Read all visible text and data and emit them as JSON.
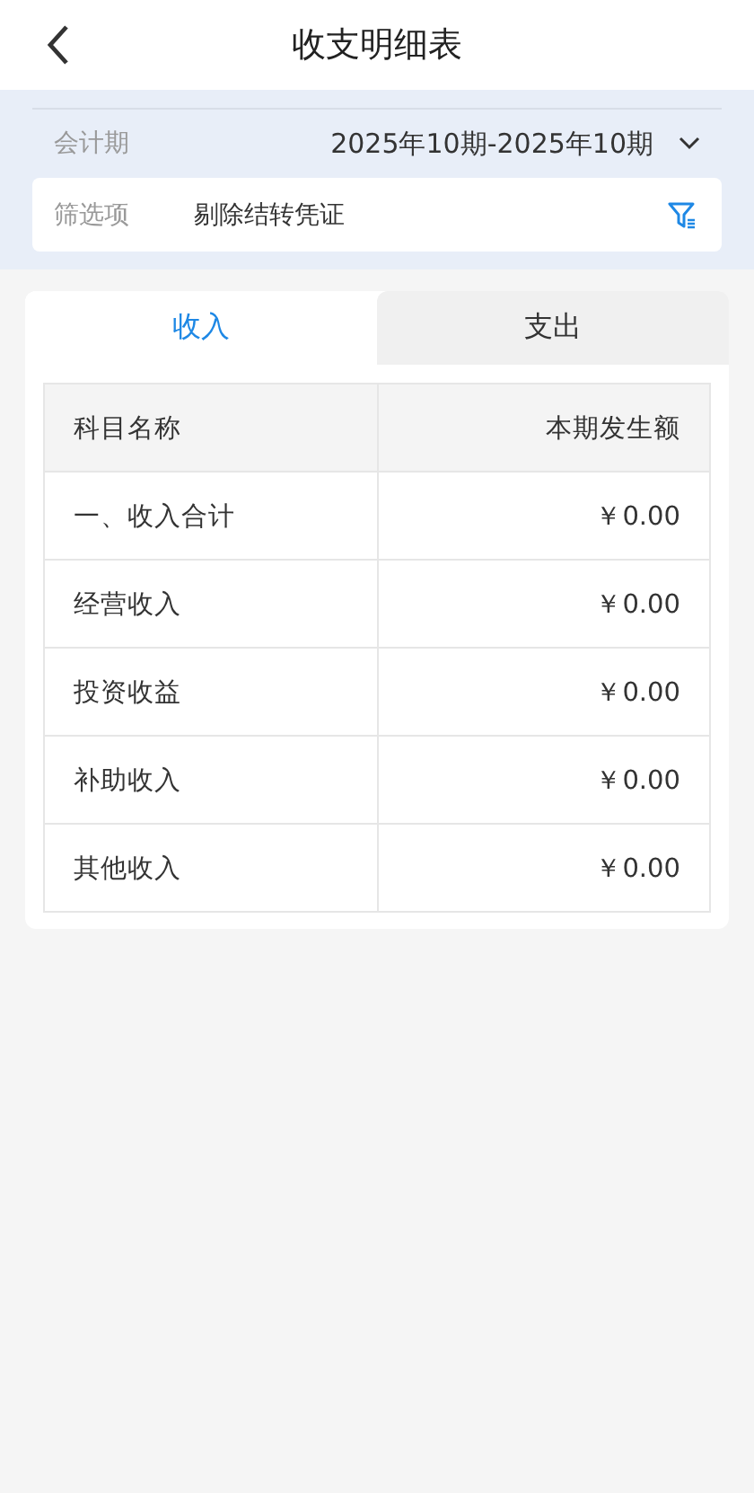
{
  "header": {
    "title": "收支明细表"
  },
  "period": {
    "label": "会计期",
    "value": "2025年10期-2025年10期"
  },
  "filter": {
    "label": "筛选项",
    "value": "剔除结转凭证"
  },
  "tabs": [
    {
      "label": "收入",
      "selected": true
    },
    {
      "label": "支出",
      "selected": false
    }
  ],
  "table": {
    "columns": [
      "科目名称",
      "本期发生额"
    ],
    "rows": [
      [
        "一、收入合计",
        "￥0.00"
      ],
      [
        "经营收入",
        "￥0.00"
      ],
      [
        "投资收益",
        "￥0.00"
      ],
      [
        "补助收入",
        "￥0.00"
      ],
      [
        "其他收入",
        "￥0.00"
      ]
    ]
  }
}
